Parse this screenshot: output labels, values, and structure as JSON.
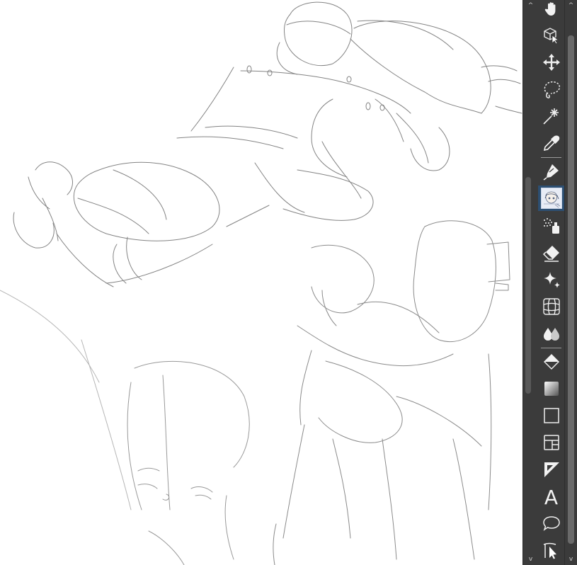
{
  "app": {
    "window": "drawing-canvas"
  },
  "canvas": {
    "background": "#ffffff",
    "stroke_color": "#6e6e6e"
  },
  "scrollbars": {
    "left_up_arrow": "^",
    "left_down_arrow": "v",
    "right_up_arrow": "^",
    "right_down_arrow": "v"
  },
  "toolbar": {
    "selected_tool": "brush",
    "tools": [
      {
        "id": "hand",
        "icon": "hand-icon"
      },
      {
        "id": "object",
        "icon": "object-select-icon"
      },
      {
        "id": "move",
        "icon": "move-icon"
      },
      {
        "id": "lasso",
        "icon": "lasso-select-icon"
      },
      {
        "id": "magic-wand",
        "icon": "magic-wand-icon"
      },
      {
        "id": "eyedropper",
        "icon": "eyedropper-icon"
      },
      {
        "id": "pen",
        "icon": "pen-icon"
      },
      {
        "id": "brush",
        "icon": "brush-thumbnail-icon"
      },
      {
        "id": "airbrush",
        "icon": "airbrush-icon"
      },
      {
        "id": "eraser",
        "icon": "eraser-icon"
      },
      {
        "id": "decoration",
        "icon": "sparkle-icon"
      },
      {
        "id": "ruler",
        "icon": "perspective-ruler-icon"
      },
      {
        "id": "blend",
        "icon": "blend-drops-icon"
      },
      {
        "id": "fill",
        "icon": "fill-bucket-icon"
      },
      {
        "id": "gradient",
        "icon": "gradient-icon"
      },
      {
        "id": "rectangle",
        "icon": "rectangle-icon"
      },
      {
        "id": "frame",
        "icon": "frame-border-icon"
      },
      {
        "id": "ruler-line",
        "icon": "ruler-triangle-icon"
      },
      {
        "id": "text",
        "icon": "text-icon",
        "label": "A"
      },
      {
        "id": "balloon",
        "icon": "speech-balloon-icon"
      },
      {
        "id": "correct-line",
        "icon": "correct-line-icon"
      }
    ]
  }
}
